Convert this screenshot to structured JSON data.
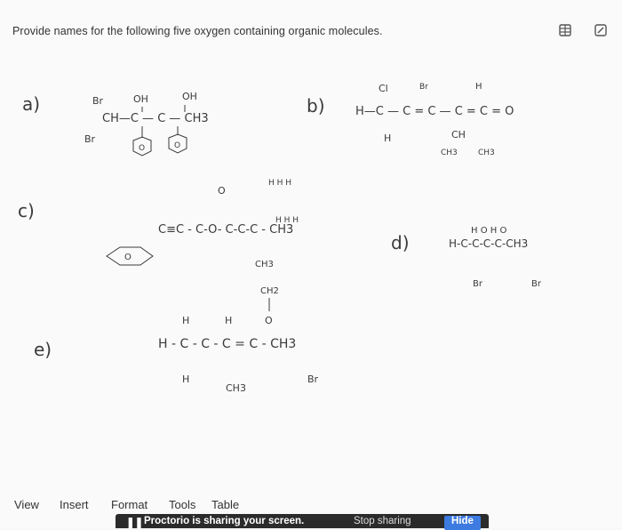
{
  "question": {
    "text": "Provide names for the following five oxygen containing organic molecules."
  },
  "toolbar": {
    "table_icon": "table-icon",
    "edit_icon": "edit-icon"
  },
  "labels": {
    "a": "a)",
    "b": "b)",
    "c": "c)",
    "d": "d)",
    "e": "e)"
  },
  "molecule_a": {
    "br1": "Br",
    "br2": "Br",
    "oh1": "OH",
    "oh2": "OH",
    "chain": "CH—C — C — CH3",
    "ring": "O"
  },
  "molecule_b": {
    "cl": "Cl",
    "br": "Br",
    "h_top": "H",
    "chain": "H—C — C = C — C = C = O",
    "h_bottom": "H",
    "ch": "CH",
    "ch3_left": "CH3",
    "ch3_right": "CH3"
  },
  "molecule_c": {
    "o_top": "O",
    "chain": "C≡C - C-O- C-C-C - CH3",
    "h_row_top": "H H H",
    "h_row_bottom": "H H H",
    "ring": "O"
  },
  "molecule_d": {
    "top": "H    O  H   O",
    "chain": "H-C-C-C-C-CH3",
    "br1": "Br",
    "br2": "Br"
  },
  "molecule_e": {
    "ch3_top": "CH3",
    "ch2": "CH2",
    "o": "O",
    "h1": "H",
    "h2": "H",
    "chain": "H - C - C - C = C - CH3",
    "h_bottom": "H",
    "ch3": "CH3",
    "br": "Br"
  },
  "menubar": {
    "view": "View",
    "insert": "Insert",
    "format": "Format",
    "tools": "Tools",
    "table": "Table"
  },
  "proctor": {
    "message": "Proctorio is sharing your screen.",
    "stop": "Stop sharing",
    "hide": "Hide"
  }
}
